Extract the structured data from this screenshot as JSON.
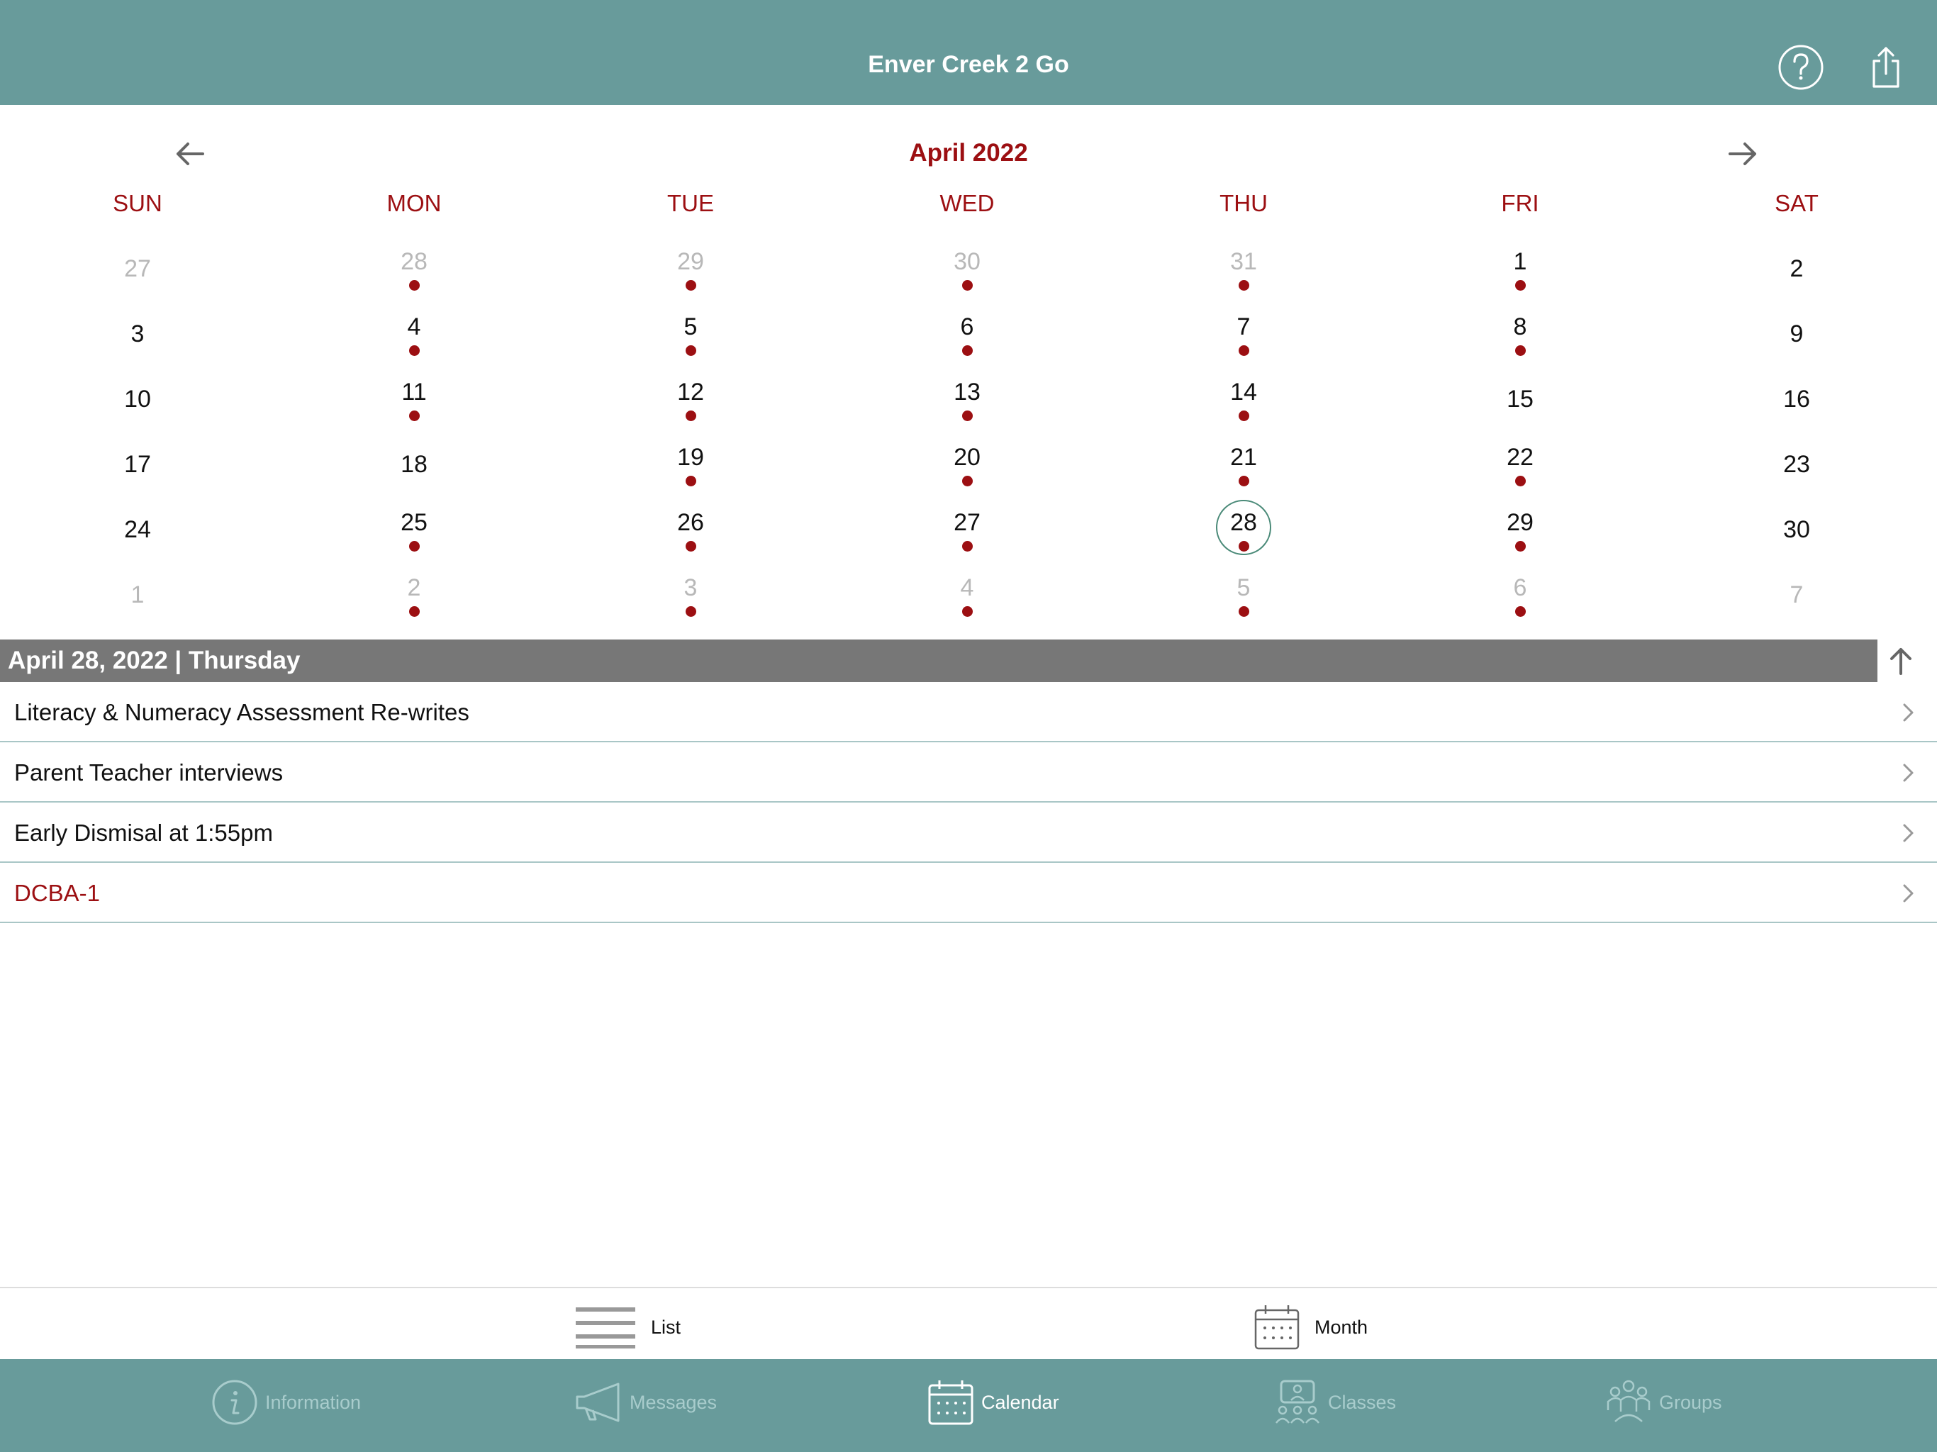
{
  "app": {
    "title": "Enver Creek 2 Go",
    "help_icon": "help-circle-icon",
    "share_icon": "share-icon"
  },
  "calendar": {
    "month_title": "April 2022",
    "weekdays": [
      "SUN",
      "MON",
      "TUE",
      "WED",
      "THU",
      "FRI",
      "SAT"
    ],
    "weeks": [
      [
        {
          "n": "27",
          "muted": true,
          "event": false
        },
        {
          "n": "28",
          "muted": true,
          "event": true
        },
        {
          "n": "29",
          "muted": true,
          "event": true
        },
        {
          "n": "30",
          "muted": true,
          "event": true
        },
        {
          "n": "31",
          "muted": true,
          "event": true
        },
        {
          "n": "1",
          "muted": false,
          "event": true
        },
        {
          "n": "2",
          "muted": false,
          "event": false
        }
      ],
      [
        {
          "n": "3",
          "muted": false,
          "event": false
        },
        {
          "n": "4",
          "muted": false,
          "event": true
        },
        {
          "n": "5",
          "muted": false,
          "event": true
        },
        {
          "n": "6",
          "muted": false,
          "event": true
        },
        {
          "n": "7",
          "muted": false,
          "event": true
        },
        {
          "n": "8",
          "muted": false,
          "event": true
        },
        {
          "n": "9",
          "muted": false,
          "event": false
        }
      ],
      [
        {
          "n": "10",
          "muted": false,
          "event": false
        },
        {
          "n": "11",
          "muted": false,
          "event": true
        },
        {
          "n": "12",
          "muted": false,
          "event": true
        },
        {
          "n": "13",
          "muted": false,
          "event": true
        },
        {
          "n": "14",
          "muted": false,
          "event": true
        },
        {
          "n": "15",
          "muted": false,
          "event": false
        },
        {
          "n": "16",
          "muted": false,
          "event": false
        }
      ],
      [
        {
          "n": "17",
          "muted": false,
          "event": false
        },
        {
          "n": "18",
          "muted": false,
          "event": false
        },
        {
          "n": "19",
          "muted": false,
          "event": true
        },
        {
          "n": "20",
          "muted": false,
          "event": true
        },
        {
          "n": "21",
          "muted": false,
          "event": true
        },
        {
          "n": "22",
          "muted": false,
          "event": true
        },
        {
          "n": "23",
          "muted": false,
          "event": false
        }
      ],
      [
        {
          "n": "24",
          "muted": false,
          "event": false
        },
        {
          "n": "25",
          "muted": false,
          "event": true
        },
        {
          "n": "26",
          "muted": false,
          "event": true
        },
        {
          "n": "27",
          "muted": false,
          "event": true
        },
        {
          "n": "28",
          "muted": false,
          "event": true,
          "selected": true
        },
        {
          "n": "29",
          "muted": false,
          "event": true
        },
        {
          "n": "30",
          "muted": false,
          "event": false
        }
      ],
      [
        {
          "n": "1",
          "muted": true,
          "event": false
        },
        {
          "n": "2",
          "muted": true,
          "event": true
        },
        {
          "n": "3",
          "muted": true,
          "event": true
        },
        {
          "n": "4",
          "muted": true,
          "event": true
        },
        {
          "n": "5",
          "muted": true,
          "event": true
        },
        {
          "n": "6",
          "muted": true,
          "event": true
        },
        {
          "n": "7",
          "muted": true,
          "event": false
        }
      ]
    ]
  },
  "selected_day": {
    "label": "April 28, 2022 | Thursday",
    "events": [
      {
        "title": "Literacy & Numeracy Assessment Re-writes",
        "highlight": false
      },
      {
        "title": "Parent Teacher interviews",
        "highlight": false
      },
      {
        "title": "Early Dismisal at 1:55pm",
        "highlight": false
      },
      {
        "title": "DCBA-1",
        "highlight": true
      }
    ]
  },
  "view_switch": {
    "list_label": "List",
    "month_label": "Month"
  },
  "tabs": {
    "information": "Information",
    "messages": "Messages",
    "calendar": "Calendar",
    "classes": "Classes",
    "groups": "Groups",
    "active": "calendar"
  },
  "colors": {
    "header_bg": "#689b9b",
    "accent_red": "#9c0f12",
    "date_bar_bg": "#777777",
    "selected_ring": "#4a8a78",
    "tab_inactive": "#a8cccc"
  }
}
